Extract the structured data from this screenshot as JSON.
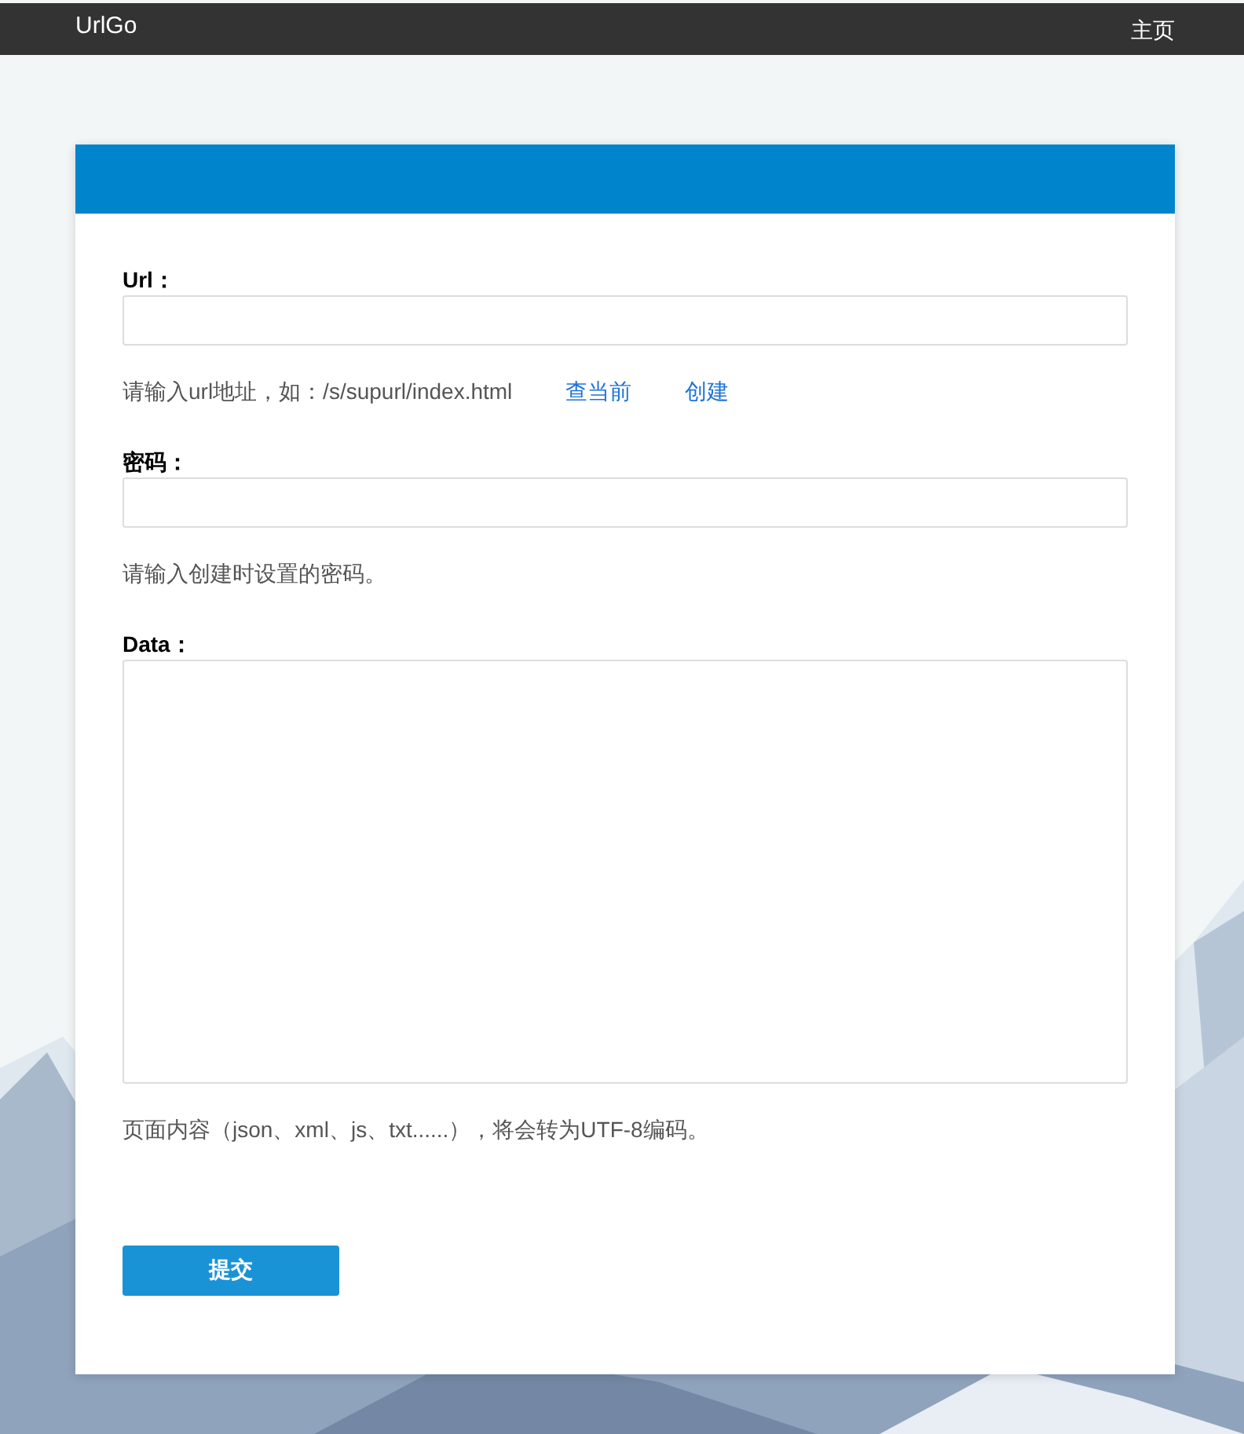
{
  "navbar": {
    "brand": "UrlGo",
    "links": [
      "主页"
    ]
  },
  "form": {
    "fields": [
      {
        "kind": "input",
        "label": "Url：",
        "hint": "请输入url地址，如：/s/supurl/index.html",
        "links": [
          "查当前",
          "创建"
        ]
      },
      {
        "kind": "input",
        "label": "密码：",
        "hint": "请输入创建时设置的密码。"
      },
      {
        "kind": "textarea",
        "label": "Data：",
        "hint": "页面内容（json、xml、js、txt......），将会转为UTF-8编码。"
      }
    ],
    "submit": "提交"
  }
}
